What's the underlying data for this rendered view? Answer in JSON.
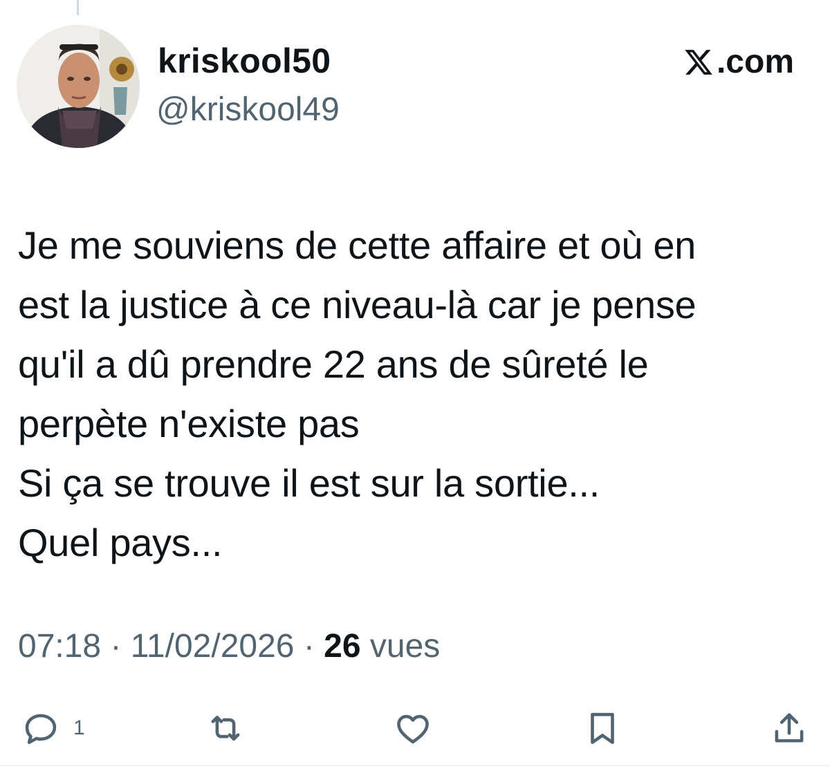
{
  "author": {
    "display_name": "kriskool50",
    "handle": "@kriskool49"
  },
  "brand": {
    "label": ".com"
  },
  "tweet": {
    "text": "Je me souviens de cette affaire et où en\nest la justice à ce niveau-là car je pense\nqu'il a dû prendre 22 ans de sûreté le\nperpète n'existe pas\nSi ça se trouve il est sur  la sortie...\nQuel pays..."
  },
  "meta": {
    "time": "07:18",
    "separator": "·",
    "date": "11/02/2026",
    "views_count": "26",
    "views_label": "vues"
  },
  "actions": {
    "reply_count": "1",
    "icons": [
      "reply-icon",
      "repost-icon",
      "like-icon",
      "bookmark-icon",
      "share-icon"
    ]
  },
  "colors": {
    "text": "#0f1419",
    "secondary": "#536471",
    "divider": "#eff3f4"
  }
}
